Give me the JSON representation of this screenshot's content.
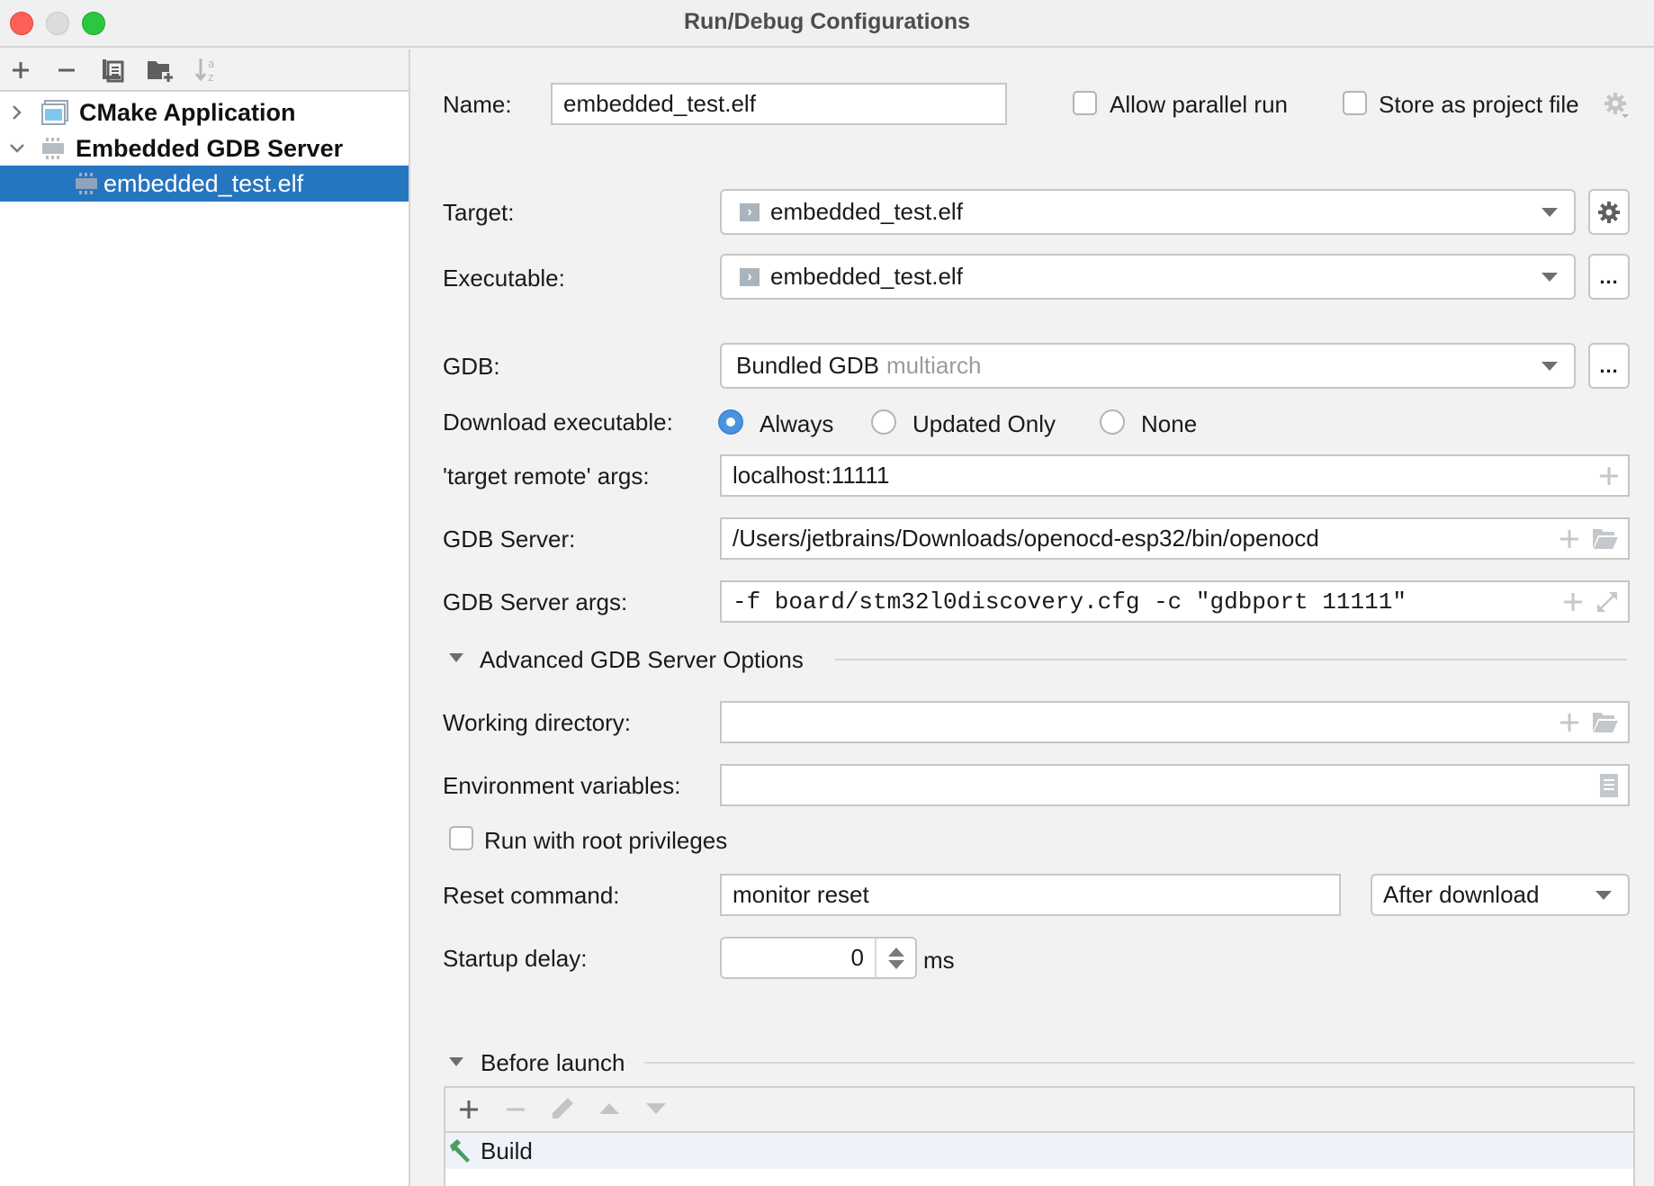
{
  "window": {
    "title": "Run/Debug Configurations"
  },
  "sidebar": {
    "toolbar": [
      {
        "icon": "plus-icon",
        "label": "Add"
      },
      {
        "icon": "minus-icon",
        "label": "Remove"
      },
      {
        "icon": "copy-icon",
        "label": "Copy"
      },
      {
        "icon": "new-folder-icon",
        "label": "New Folder"
      },
      {
        "icon": "sort-alpha-icon",
        "label": "Sort"
      }
    ],
    "tree": [
      {
        "label": "CMake Application",
        "expanded": false,
        "level": 0
      },
      {
        "label": "Embedded GDB Server",
        "expanded": true,
        "level": 0
      },
      {
        "label": "embedded_test.elf",
        "selected": true,
        "level": 1
      }
    ]
  },
  "form": {
    "name": {
      "label": "Name:",
      "value": "embedded_test.elf"
    },
    "allow_parallel": {
      "label": "Allow parallel run",
      "checked": false
    },
    "store_project": {
      "label": "Store as project file",
      "checked": false
    },
    "target": {
      "label": "Target:",
      "value": "embedded_test.elf"
    },
    "executable": {
      "label": "Executable:",
      "value": "embedded_test.elf",
      "browse": "..."
    },
    "gdb": {
      "label": "GDB:",
      "value": "Bundled GDB",
      "hint": "multiarch",
      "browse": "..."
    },
    "download": {
      "label": "Download executable:",
      "options": [
        "Always",
        "Updated Only",
        "None"
      ],
      "selected": "Always"
    },
    "target_remote": {
      "label": "'target remote' args:",
      "value": "localhost:11111"
    },
    "gdb_server": {
      "label": "GDB Server:",
      "value": "/Users/jetbrains/Downloads/openocd-esp32/bin/openocd"
    },
    "gdb_server_args": {
      "label": "GDB Server args:",
      "value": "-f board/stm32l0discovery.cfg -c \"gdbport 11111\""
    },
    "advanced": {
      "label": "Advanced GDB Server Options",
      "expanded": true
    },
    "working_dir": {
      "label": "Working directory:",
      "value": ""
    },
    "env_vars": {
      "label": "Environment variables:",
      "value": ""
    },
    "run_root": {
      "label": "Run with root privileges",
      "checked": false
    },
    "reset_command": {
      "label": "Reset command:",
      "value": "monitor reset",
      "mode": "After download"
    },
    "startup_delay": {
      "label": "Startup delay:",
      "value": "0",
      "unit": "ms"
    }
  },
  "before_launch": {
    "label": "Before launch",
    "expanded": true,
    "toolbar": [
      "add",
      "remove",
      "edit",
      "move-up",
      "move-down"
    ],
    "items": [
      {
        "label": "Build",
        "icon": "hammer-icon"
      }
    ]
  },
  "colors": {
    "selection": "#2675bf",
    "radio_on": "#4a94df",
    "build_icon": "#4c9e5f"
  }
}
